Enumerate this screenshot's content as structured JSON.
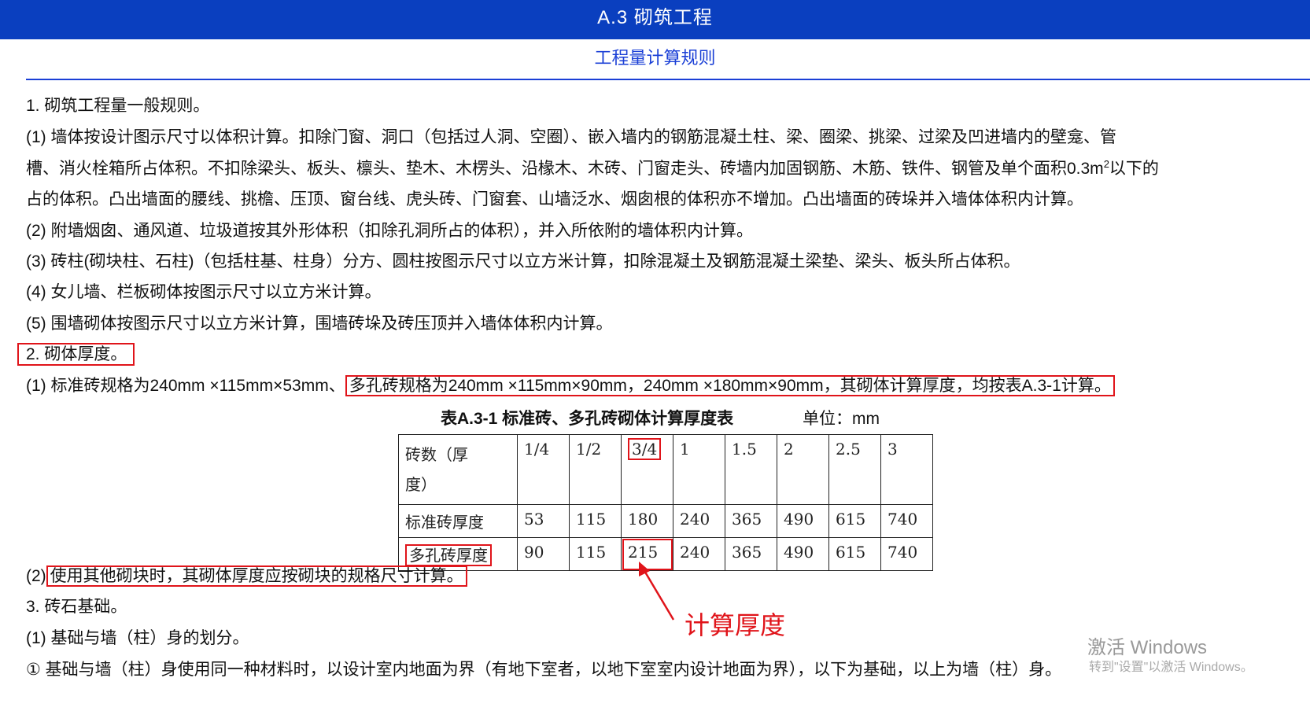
{
  "header": {
    "title": "A.3 砌筑工程",
    "subtitle": "工程量计算规则"
  },
  "body": {
    "l1": "1. 砌筑工程量一般规则。",
    "l2": "(1)     墙体按设计图示尺寸以体积计算。扣除门窗、洞口（包括过人洞、空圈）、嵌入墙内的钢筋混凝土柱、梁、圈梁、挑梁、过梁及凹进墙内的壁龛、管",
    "l3a": "槽、消火栓箱所占体积。不扣除梁头、板头、檩头、垫木、木楞头、沿椽木、木砖、门窗走头、砖墙内加固钢筋、木筋、铁件、钢管及单个面积0.3m",
    "l3sup": "2",
    "l3b": "以下的",
    "l4": "占的体积。凸出墙面的腰线、挑檐、压顶、窗台线、虎头砖、门窗套、山墙泛水、烟囱根的体积亦不增加。凸出墙面的砖垛并入墙体体积内计算。",
    "l5": "(2) 附墙烟囱、通风道、垃圾道按其外形体积（扣除孔洞所占的体积），并入所依附的墙体积内计算。",
    "l6": "(3) 砖柱(砌块柱、石柱)（包括柱基、柱身）分方、圆柱按图示尺寸以立方米计算，扣除混凝土及钢筋混凝土梁垫、梁头、板头所占体积。",
    "l7": "(4) 女儿墙、栏板砌体按图示尺寸以立方米计算。",
    "l8": " (5) 围墙砌体按图示尺寸以立方米计算，围墙砖垛及砖压顶并入墙体体积内计算。",
    "l9": "2. 砌体厚度。",
    "l10a": "(1) 标准砖规格为240mm ×115mm×53mm、",
    "l10b": "多孔砖规格为240mm ×115mm×90mm，240mm ×180mm×90mm，其砌体计算厚度，均按表A.3-1计算。",
    "l11a": "(2)",
    "l11b": "使用其他砌块时，其砌体厚度应按砌块的规格尺寸计算。",
    "l12": "3. 砖石基础。",
    "l13": "(1) 基础与墙（柱）身的划分。",
    "l14": "① 基础与墙（柱）身使用同一种材料时，以设计室内地面为界（有地下室者，以地下室室内设计地面为界），以下为基础，以上为墙（柱）身。"
  },
  "table": {
    "caption": "表A.3-1 标准砖、多孔砖砌体计算厚度表",
    "unit": "单位：mm",
    "header_label_1": "砖数（厚",
    "header_label_2": "度）",
    "cols": [
      "1/4",
      "1/2",
      "3/4",
      "1",
      "1.5",
      "2",
      "2.5",
      "3"
    ],
    "row1_label": "标准砖厚度",
    "row1": [
      "53",
      "115",
      "180",
      "240",
      "365",
      "490",
      "615",
      "740"
    ],
    "row2_label": "多孔砖厚度",
    "row2": [
      "90",
      "115",
      "215",
      "240",
      "365",
      "490",
      "615",
      "740"
    ]
  },
  "annotation": {
    "text": "计算厚度"
  },
  "watermark": {
    "line1": "激活 Windows",
    "line2": "转到\"设置\"以激活 Windows。"
  }
}
